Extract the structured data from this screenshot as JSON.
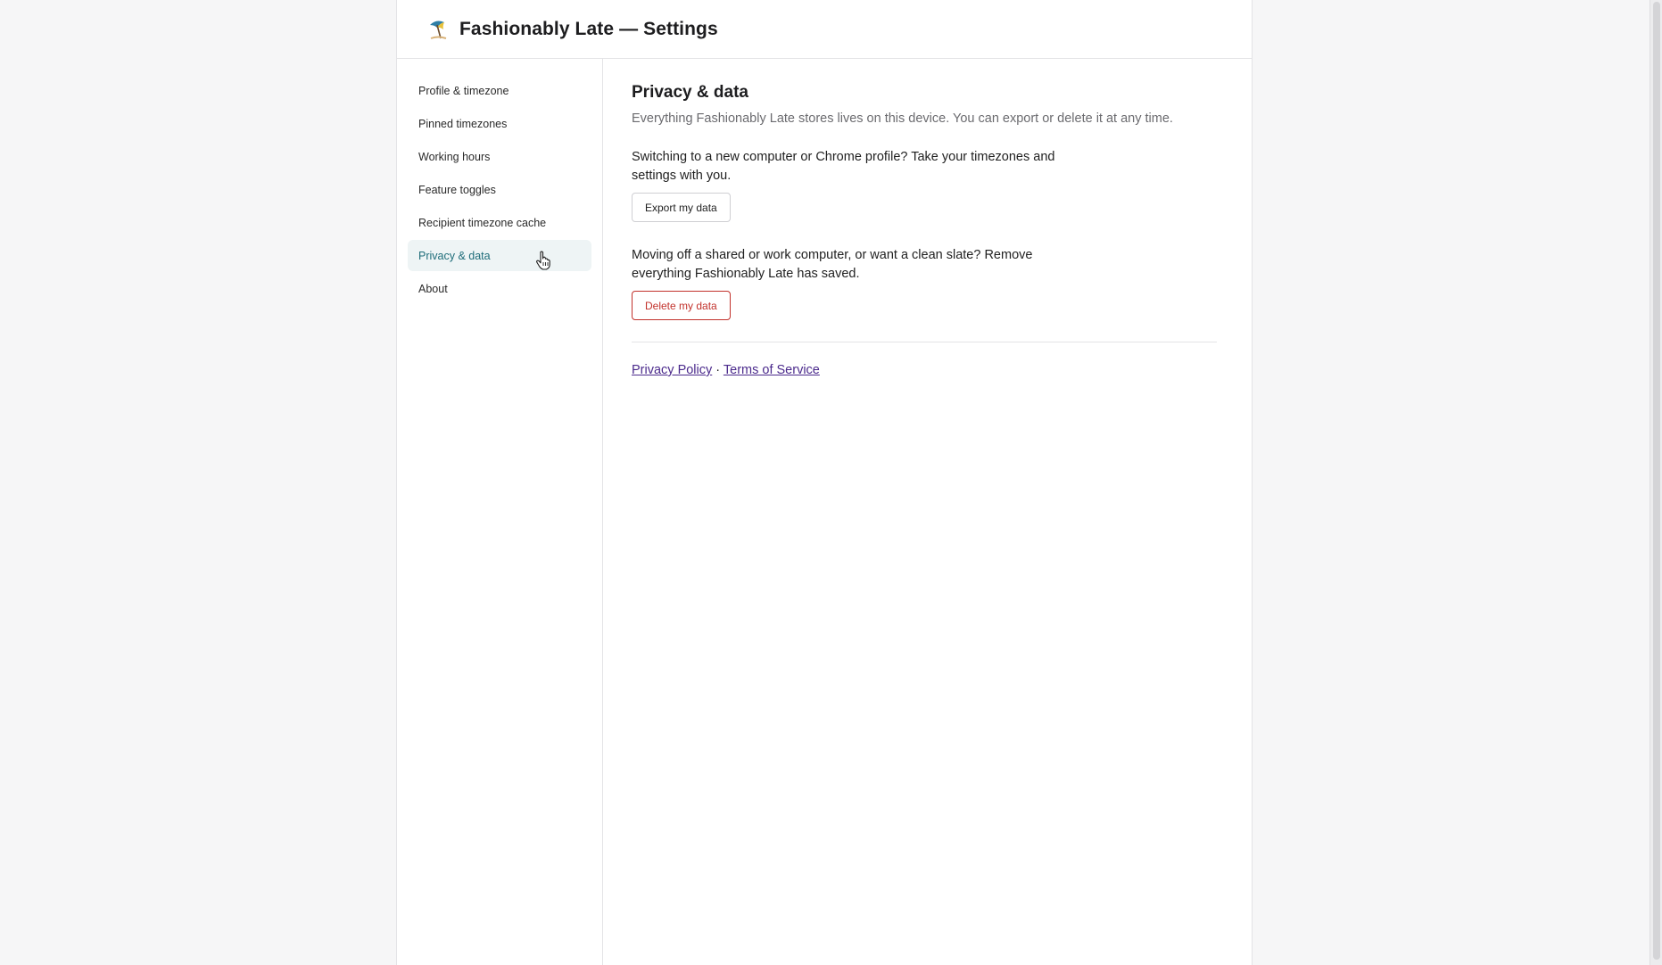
{
  "header": {
    "title": "Fashionably Late — Settings",
    "logo_icon": "beach-umbrella-icon"
  },
  "sidebar": {
    "items": [
      {
        "label": "Profile & timezone",
        "active": false
      },
      {
        "label": "Pinned timezones",
        "active": false
      },
      {
        "label": "Working hours",
        "active": false
      },
      {
        "label": "Feature toggles",
        "active": false
      },
      {
        "label": "Recipient timezone cache",
        "active": false
      },
      {
        "label": "Privacy & data",
        "active": true
      },
      {
        "label": "About",
        "active": false
      }
    ]
  },
  "main": {
    "title": "Privacy & data",
    "subtitle": "Everything Fashionably Late stores lives on this device. You can export or delete it at any time.",
    "export": {
      "description": "Switching to a new computer or Chrome profile? Take your timezones and settings with you.",
      "button_label": "Export my data"
    },
    "delete": {
      "description": "Moving off a shared or work computer, or want a clean slate? Remove everything Fashionably Late has saved.",
      "button_label": "Delete my data"
    },
    "footer": {
      "privacy_link": "Privacy Policy",
      "separator": "·",
      "terms_link": "Terms of Service"
    }
  },
  "colors": {
    "accent": "#1f6d7a",
    "active_bg": "#eef4f5",
    "danger": "#c2312b",
    "link": "#4b2a8c"
  }
}
